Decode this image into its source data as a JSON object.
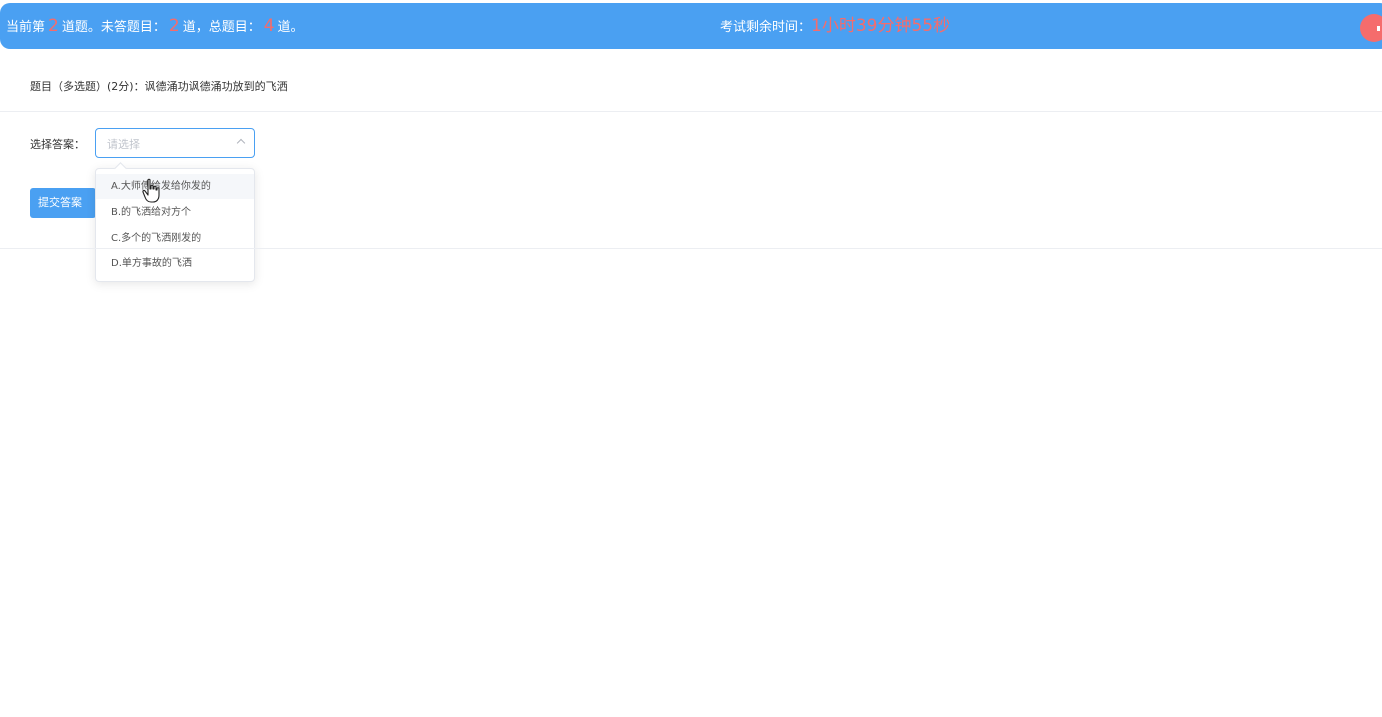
{
  "header": {
    "progress_prefix": "当前第",
    "current_index": "2",
    "progress_mid": "道题。未答题目：",
    "unanswered_count": "2",
    "progress_mid2": "道，总题目：",
    "total_count": "4",
    "progress_suffix": "道。",
    "timer_label": "考试剩余时间：",
    "timer_value": "1小时39分钟55秒"
  },
  "question": {
    "text": "题目（多选题）(2分)：讽德涌功讽德涌功放到的飞洒"
  },
  "answer": {
    "label": "选择答案：",
    "placeholder": "请选择",
    "options": [
      "A.大师傅给发给你发的",
      "B.的飞洒给对方个",
      "C.多个的飞洒刚发的",
      "D.单方事故的飞洒"
    ]
  },
  "submit": {
    "label": "提交答案"
  },
  "colors": {
    "primary": "#4aa0f2",
    "danger": "#f56c6c"
  }
}
